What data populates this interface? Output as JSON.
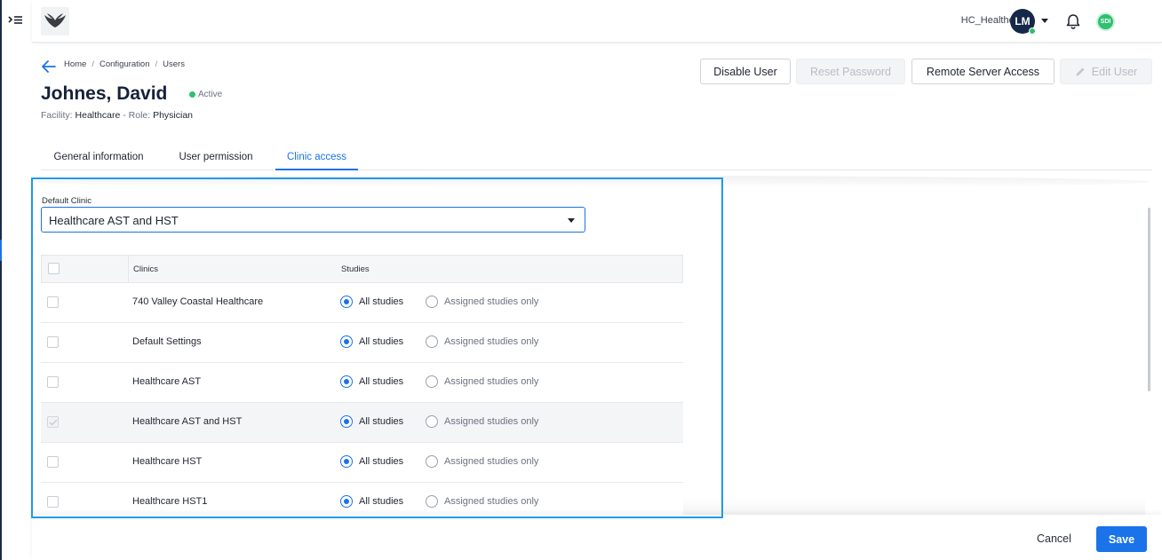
{
  "topbar": {
    "tenant": "HC_Healthcare",
    "avatar_initials": "LM",
    "org_badge": "SDI"
  },
  "breadcrumb": [
    "Home",
    "Configuration",
    "Users"
  ],
  "user": {
    "name": "Johnes, David",
    "status": "Active",
    "facility_label": "Facility:",
    "facility": "Healthcare",
    "role_label": "Role:",
    "role": "Physician",
    "meta_separator": " - "
  },
  "actions": {
    "disable_user": "Disable User",
    "reset_password": "Reset Password",
    "remote_server_access": "Remote Server Access",
    "edit_user": "Edit User"
  },
  "tabs": [
    "General information",
    "User permission",
    "Clinic access"
  ],
  "active_tab": "Clinic access",
  "default_clinic": {
    "label": "Default Clinic",
    "value": "Healthcare AST and HST"
  },
  "table": {
    "headers": {
      "clinics": "Clinics",
      "studies": "Studies"
    },
    "option_all": "All studies",
    "option_assigned": "Assigned studies only",
    "rows": [
      {
        "clinic": "740 Valley Coastal Healthcare",
        "checked": false,
        "study_scope": "all"
      },
      {
        "clinic": "Default Settings",
        "checked": false,
        "study_scope": "all"
      },
      {
        "clinic": "Healthcare AST",
        "checked": false,
        "study_scope": "all"
      },
      {
        "clinic": "Healthcare AST and HST",
        "checked": true,
        "study_scope": "all"
      },
      {
        "clinic": "Healthcare HST",
        "checked": false,
        "study_scope": "all"
      },
      {
        "clinic": "Healthcare HST1",
        "checked": false,
        "study_scope": "all"
      }
    ]
  },
  "footer": {
    "cancel": "Cancel",
    "save": "Save"
  },
  "colors": {
    "primary": "#1a73e8",
    "active_status": "#2fbf71",
    "highlight": "#1e9be6",
    "navy": "#16284a"
  }
}
